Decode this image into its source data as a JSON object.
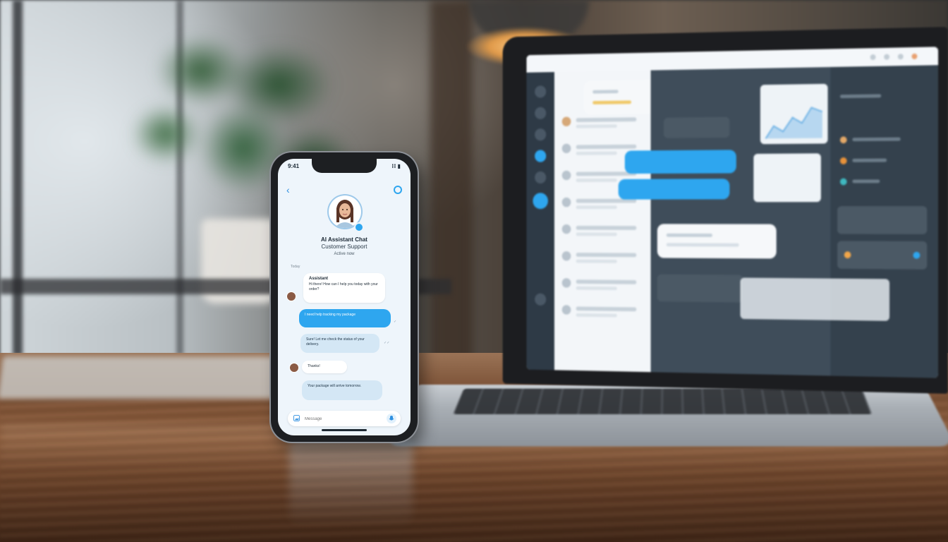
{
  "phone": {
    "status_time": "9:41",
    "status_icons": "⁝⁝ ▮",
    "contact_title": "AI Assistant Chat",
    "contact_subtitle": "Customer Support",
    "contact_status": "Active now",
    "section_label": "Today",
    "messages": [
      {
        "title": "Assistant",
        "text": "Hi there! How can I help you today with your order?"
      },
      {
        "text": "I need help tracking my package"
      },
      {
        "text": "Sure! Let me check the status of your delivery."
      },
      {
        "text": "Thanks!"
      },
      {
        "text": "Your package will arrive tomorrow."
      }
    ],
    "composer_placeholder": "Message"
  },
  "colors": {
    "accent": "#2ea6ef",
    "bubble_soft": "#d4e7f5",
    "laptop_panel": "#3f4d5a"
  }
}
